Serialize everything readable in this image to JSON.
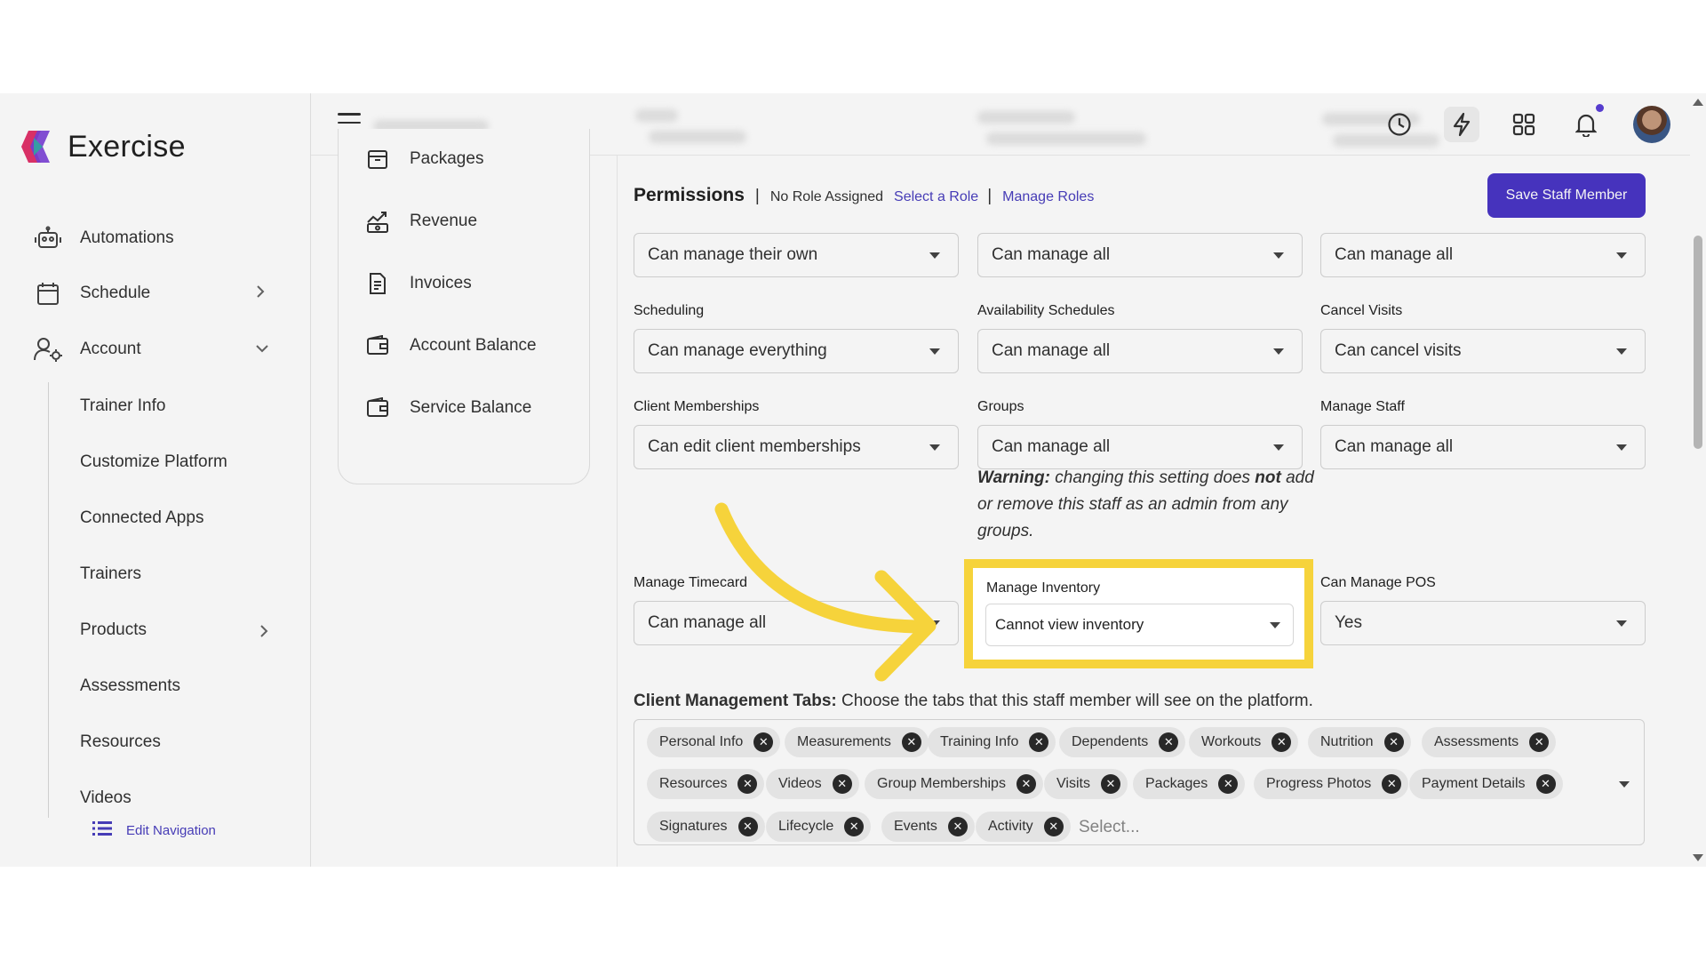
{
  "app": {
    "name": "Exercise"
  },
  "sidebar": {
    "items": [
      {
        "label": "Automations",
        "icon": "robot-icon"
      },
      {
        "label": "Schedule",
        "icon": "calendar-icon"
      },
      {
        "label": "Account",
        "icon": "user-gear-icon"
      }
    ],
    "account_children": [
      "Trainer Info",
      "Customize Platform",
      "Connected Apps",
      "Trainers",
      "Products",
      "Assessments",
      "Resources",
      "Videos"
    ],
    "edit_navigation": "Edit Navigation"
  },
  "submenu": {
    "items": [
      {
        "label": "Packages",
        "icon": "package-icon"
      },
      {
        "label": "Revenue",
        "icon": "revenue-icon"
      },
      {
        "label": "Invoices",
        "icon": "invoice-icon"
      },
      {
        "label": "Account Balance",
        "icon": "wallet-icon"
      },
      {
        "label": "Service Balance",
        "icon": "wallet-icon"
      }
    ]
  },
  "header": {
    "permissions_title": "Permissions",
    "no_role": "No Role Assigned",
    "select_role": "Select a Role",
    "manage_roles": "Manage Roles",
    "save_button": "Save Staff Member"
  },
  "fields": {
    "row0": [
      "Can manage their own",
      "Can manage all",
      "Can manage all"
    ],
    "scheduling": {
      "label": "Scheduling",
      "value": "Can manage everything"
    },
    "availability": {
      "label": "Availability Schedules",
      "value": "Can manage all"
    },
    "cancel_visits": {
      "label": "Cancel Visits",
      "value": "Can cancel visits"
    },
    "client_memberships": {
      "label": "Client Memberships",
      "value": "Can edit client memberships"
    },
    "groups": {
      "label": "Groups",
      "value": "Can manage all"
    },
    "manage_staff": {
      "label": "Manage Staff",
      "value": "Can manage all"
    },
    "warning_prefix": "Warning:",
    "warning_mid": " changing this setting does ",
    "warning_bold": "not",
    "warning_suffix": " add or remove this staff as an admin from any groups.",
    "manage_timecard": {
      "label": "Manage Timecard",
      "value": "Can manage all"
    },
    "manage_inventory": {
      "label": "Manage Inventory",
      "value": "Cannot view inventory"
    },
    "can_manage_pos": {
      "label": "Can Manage POS",
      "value": "Yes"
    }
  },
  "client_tabs": {
    "heading": "Client Management Tabs:",
    "description": " Choose the tabs that this staff member will see on the platform.",
    "tags": [
      "Personal Info",
      "Measurements",
      "Training Info",
      "Dependents",
      "Workouts",
      "Nutrition",
      "Assessments",
      "Resources",
      "Videos",
      "Group Memberships",
      "Visits",
      "Packages",
      "Progress Photos",
      "Payment Details",
      "Signatures",
      "Lifecycle",
      "Events",
      "Activity"
    ],
    "remove_glyph": "✕",
    "placeholder": "Select..."
  },
  "colors": {
    "accent": "#4a36c6",
    "highlight": "#f6d33b",
    "annotation_arrow": "#f6d33b"
  }
}
